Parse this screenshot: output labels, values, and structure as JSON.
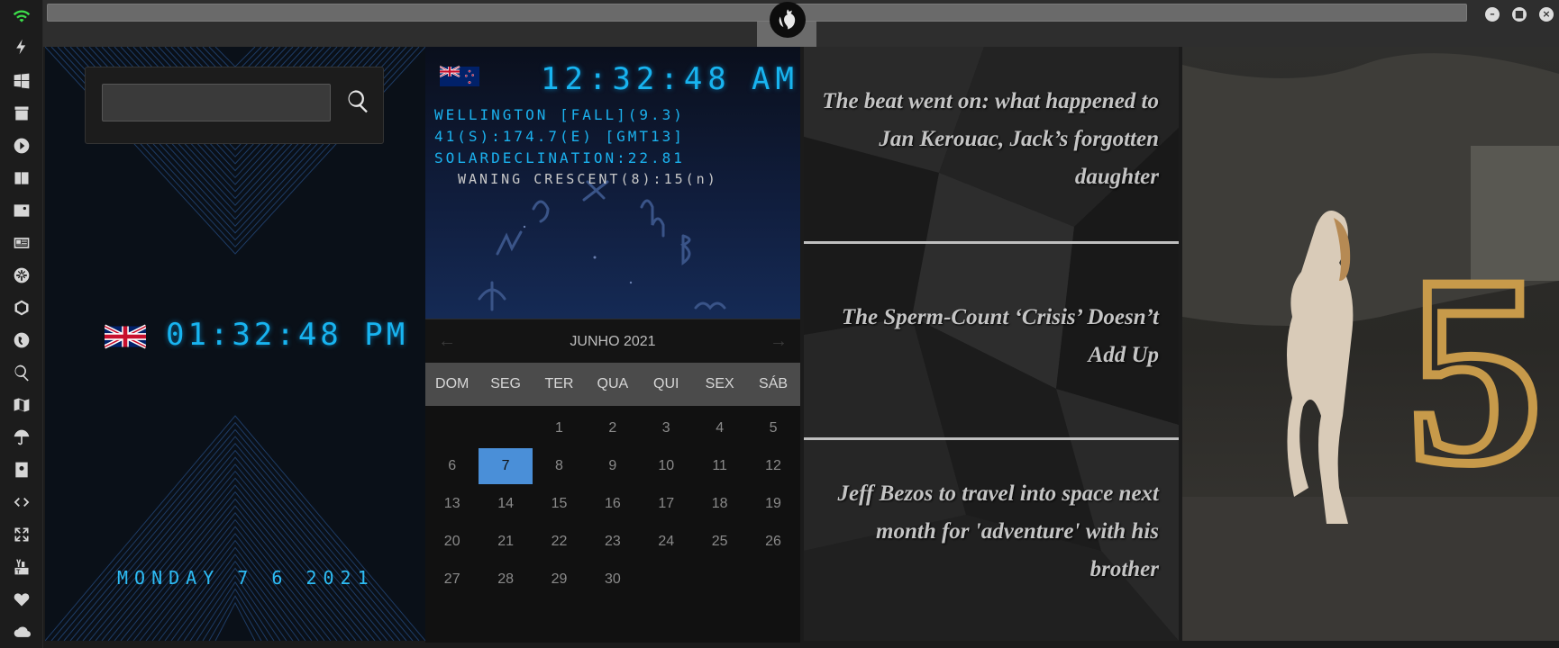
{
  "topbar": {
    "url_value": "",
    "window_controls": [
      "minimize",
      "maximize",
      "close"
    ]
  },
  "rail": {
    "icons": [
      "wifi-icon",
      "bolt-icon",
      "windows-icon",
      "archive-icon",
      "play-icon",
      "translate-icon",
      "image-icon",
      "news-icon",
      "snowflake-icon",
      "hexagon-icon",
      "globe-icon",
      "search-icon",
      "map-icon",
      "umbrella-icon",
      "contacts-icon",
      "code-icon",
      "fullscreen-icon",
      "youtube-icon",
      "heart-icon",
      "cloud-icon"
    ],
    "accent": "#3ddc4a"
  },
  "search": {
    "value": "",
    "placeholder": ""
  },
  "uk_clock": {
    "time": "01:32:48 PM",
    "date": "MONDAY 7 6 2021"
  },
  "nz_clock": {
    "time": "12:32:48",
    "ampm": "AM",
    "line1": "WELLINGTON [FALL](9.3)",
    "line2": "41(S):174.7(E) [GMT13]",
    "line3": "SOLARDECLINATION:22.81",
    "moon": "WANING CRESCENT(8):15(n)"
  },
  "calendar": {
    "title": "JUNHO 2021",
    "prev": "←",
    "next": "→",
    "dows": [
      "DOM",
      "SEG",
      "TER",
      "QUA",
      "QUI",
      "SEX",
      "SÁB"
    ],
    "weeks": [
      [
        "",
        "",
        "1",
        "2",
        "3",
        "4",
        "5"
      ],
      [
        "6",
        "7",
        "8",
        "9",
        "10",
        "11",
        "12"
      ],
      [
        "13",
        "14",
        "15",
        "16",
        "17",
        "18",
        "19"
      ],
      [
        "20",
        "21",
        "22",
        "23",
        "24",
        "25",
        "26"
      ],
      [
        "27",
        "28",
        "29",
        "30",
        "",
        "",
        ""
      ]
    ],
    "today": "7",
    "today_color": "#4a8fd8"
  },
  "news": [
    {
      "title": "The beat went on: what happened to Jan Kerouac, Jack’s forgotten daughter"
    },
    {
      "title": "The Sperm-Count ‘Crisis’ Doesn’t Add Up"
    },
    {
      "title": "Jeff Bezos to travel into space next month for 'adventure' with his brother"
    }
  ],
  "photo": {
    "numeral": "5"
  }
}
